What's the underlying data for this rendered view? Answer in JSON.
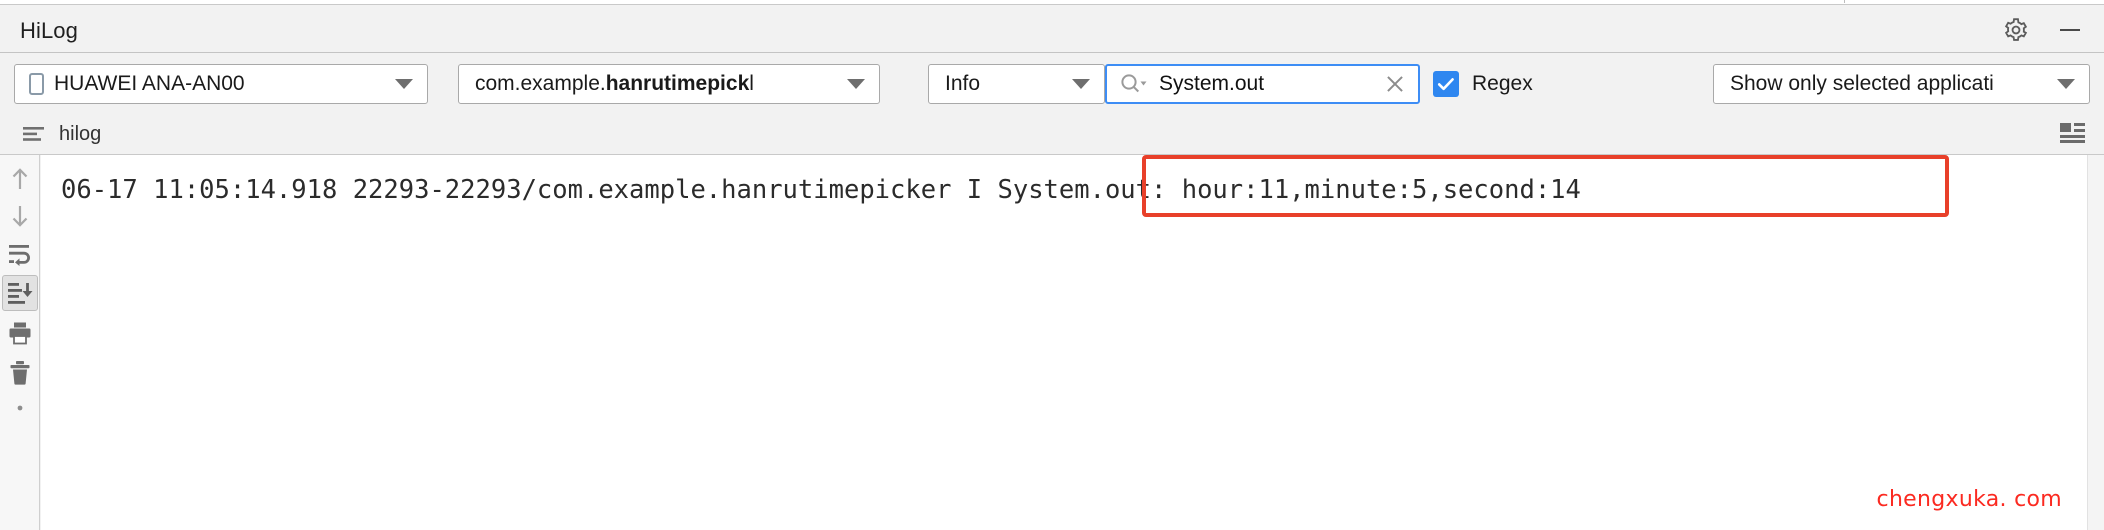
{
  "window": {
    "title": "HiLog",
    "settings_icon": "gear-icon",
    "minimize_icon": "minimize-icon"
  },
  "toolbar": {
    "device": {
      "value": "HUAWEI ANA-AN00",
      "icon": "phone-icon",
      "caret": "chevron-down-icon"
    },
    "package": {
      "prefix": "com.example.",
      "bold": "hanrutimepick",
      "suffix": "l",
      "caret": "chevron-down-icon"
    },
    "level": {
      "value": "Info",
      "caret": "chevron-down-icon"
    },
    "search": {
      "value": "System.out",
      "placeholder": "Search",
      "icon": "search-icon",
      "clear_icon": "close-icon"
    },
    "regex": {
      "label": "Regex",
      "checked": true,
      "color": "#2f87f0"
    },
    "scope": {
      "value": "Show only selected applicati",
      "caret": "chevron-down-icon"
    }
  },
  "tabs": {
    "hilog": {
      "label": "hilog",
      "icon": "log-lines-icon"
    },
    "layout_toggle_icon": "split-layout-icon"
  },
  "gutter": {
    "items": [
      {
        "name": "scroll-up-button",
        "icon": "arrow-up-icon",
        "active": false
      },
      {
        "name": "scroll-down-button",
        "icon": "arrow-down-icon",
        "active": false
      },
      {
        "name": "soft-wrap-button",
        "icon": "soft-wrap-icon",
        "active": false
      },
      {
        "name": "scroll-to-end-button",
        "icon": "scroll-to-end-icon",
        "active": true
      },
      {
        "name": "print-button",
        "icon": "printer-icon",
        "active": false
      },
      {
        "name": "clear-log-button",
        "icon": "trash-icon",
        "active": false
      }
    ]
  },
  "log": {
    "line": "06-17 11:05:14.918 22293-22293/com.example.hanrutimepicker I System.out: hour:11,minute:5,second:14",
    "highlight": {
      "text": "hour:11,minute:5,second:14",
      "color": "#e8402a"
    }
  },
  "watermark": {
    "text": "chengxuka. com",
    "color": "#fb2a21"
  }
}
